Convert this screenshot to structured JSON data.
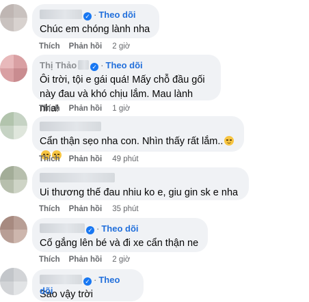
{
  "actions": {
    "like": "Thích",
    "reply": "Phản hồi"
  },
  "follow_label": "Theo dõi",
  "comments": [
    {
      "text": "Chúc em chóng lành nha",
      "time": "2 giờ",
      "name_prefix": ""
    },
    {
      "text": "Ôi trời, tội e gái quá! Mấy chỗ đầu gối này đau và khó chịu lắm. Mau lành nha!",
      "time": "1 giờ",
      "name_prefix": "Thị Thảo"
    },
    {
      "text": "Cẩn thận sẹo nha con. Nhìn thấy rất lắm..",
      "time": "49 phút",
      "emoji_count": 3,
      "emoji_name": "pensive-face"
    },
    {
      "text": "Ui thương thế đau nhiu ko e, giu gin sk e nha",
      "time": "35 phút"
    },
    {
      "text": "Cố gắng lên bé và đi xe cẩn thận ne",
      "time": "2 giờ"
    },
    {
      "text": "Sao vậy trời",
      "time": ""
    }
  ],
  "colors": {
    "bubble": "#f0f2f5",
    "follow": "#216fdb",
    "meta": "#65676b",
    "verified": "#1877f2"
  }
}
